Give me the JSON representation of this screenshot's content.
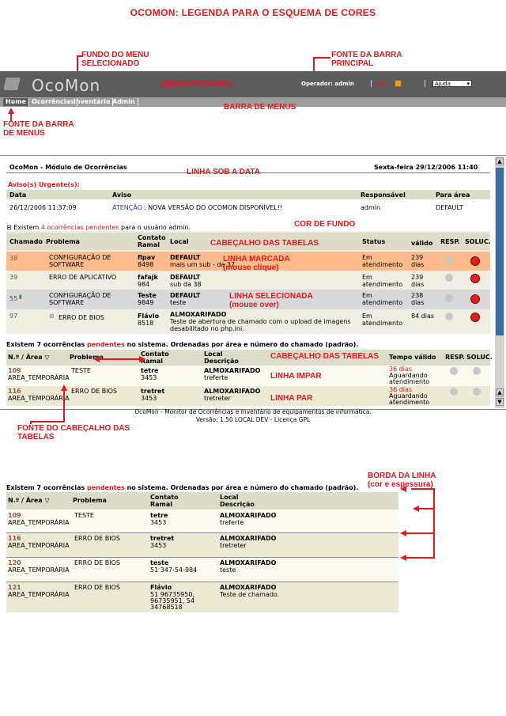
{
  "title": "OCOMON: LEGENDA PARA O ESQUEMA DE CORES",
  "annotations": {
    "fundo_menu_sel": "FUNDO DO MENU\nSELECIONADO",
    "fonte_barra_principal": "FONTE DA BARRA\nPRINCIPAL",
    "barra_principal": "BARRA PRINCIPAL",
    "barra_de_menus": "BARRA DE MENUS",
    "fonte_barra_menus": "FONTE DA BARRA\nDE MENUS",
    "linha_sob_data": "LINHA SOB A DATA",
    "cor_de_fundo": "COR DE FUNDO",
    "cabecalho_tabelas": "CABEÇALHO DAS TABELAS",
    "linha_marcada": "LINHA MARCADA",
    "mouse_clique": "(mouse clique)",
    "linha_selecionada": "LINHA SELECIONADA",
    "mouse_over": "(mouse over)",
    "cabecalho_tabelas2": "CABEÇALHO DAS TABELAS",
    "linha_impar": "LINHA IMPAR",
    "linha_par": "LINHA PAR",
    "fonte_cabecalho": "FONTE DO CABEÇALHO DAS\nTABELAS",
    "borda_linha": "BORDA DA LINHA\n(cor e espessura)"
  },
  "app": {
    "logo": "OcoMon",
    "operator": "Operador: admin",
    "sair": "sair",
    "select_value": "Ajuda",
    "menu": [
      "Home",
      "Ocorrências",
      "Inventário",
      "Admin"
    ]
  },
  "module": {
    "heading": "OcoMon - Módulo de Ocorrências",
    "date": "Sexta-feira 29/12/2006 11:40",
    "urgent_label": "Aviso(s) Urgente(s):",
    "notice_headers": [
      "Data",
      "Aviso",
      "Responsável",
      "Para área"
    ],
    "notice": {
      "data": "26/12/2006 11:37:09",
      "atencao": "ATENÇÃO",
      "msg": ": NOVA VERSÃO DO OCOMON DISPONÍVEL!!",
      "resp": "admin",
      "area": "DEFAULT"
    },
    "pend_prefix": "Existem ",
    "pend_count": "4 ocorrências pendentes",
    "pend_suffix": " para o usuário admin.",
    "headers": {
      "chamado": "Chamado",
      "problema": "Problema",
      "contato": "Contato",
      "ramal": "Ramal",
      "local": "Local",
      "status": "Status",
      "valido": "válido",
      "resp": "RESP.",
      "soluc": "SOLUC."
    },
    "rows": [
      {
        "chamado": "38",
        "problema": "CONFIGURAÇÃO DE",
        "problema2": "SOFTWARE",
        "contato": "flpav",
        "ramal": "8498",
        "local": "DEFAULT",
        "local2": "mais um sub - da 37",
        "status": "Em",
        "status2": "atendimento",
        "valido": "239",
        "valido2": "dias"
      },
      {
        "chamado": "39",
        "problema": "ERRO DE APLICATIVO",
        "problema2": "",
        "contato": "fafajk",
        "ramal": "984",
        "local": "DEFAULT",
        "local2": "sub da 38",
        "status": "Em",
        "status2": "atendimento",
        "valido": "239",
        "valido2": "dias"
      },
      {
        "chamado": "55",
        "problema": "CONFIGURAÇÃO DE",
        "problema2": "SOFTWARE",
        "contato": "Teste",
        "ramal": "9849",
        "local": "DEFAULT",
        "local2": "teste",
        "status": "Em",
        "status2": "atendimento",
        "valido": "238",
        "valido2": "dias"
      },
      {
        "chamado": "97",
        "problema": "ERRO DE BIOS",
        "problema2": "",
        "contato": "Flávio",
        "ramal": "8518",
        "local": "ALMOXARIFADO",
        "local2": "Teste de abertura de chamado com o upload de imagens",
        "local3": "desabilitado no php.ini.",
        "status": "Em",
        "status2": "atendimento",
        "valido": "84 dias",
        "valido2": ""
      }
    ],
    "sys_prefix": "Existem 7 ocorrências ",
    "sys_pend": "pendentes",
    "sys_suffix": " no sistema. Ordenadas por área e número do chamado (padrão).",
    "t2_headers": {
      "num": "N.º / Área ▽",
      "problema": "Problema",
      "contato": "Contato",
      "ramal": "Ramal",
      "local": "Local",
      "descricao": "Descrição",
      "tempo": "Tempo válido",
      "resp": "RESP.",
      "soluc": "SOLUC."
    },
    "t2_rows": [
      {
        "num": "109",
        "area": "AREA_TEMPORÁRIA",
        "problema": "TESTE",
        "contato": "tetre",
        "ramal": "3453",
        "local": "ALMOXARIFADO",
        "desc": "treferte",
        "tempo": "36 dias",
        "t2": "Aguardando",
        "t3": "atendimento"
      },
      {
        "num": "116",
        "area": "AREA_TEMPORÁRIA",
        "problema": "ERRO DE BIOS",
        "contato": "tretret",
        "ramal": "3453",
        "local": "ALMOXARIFADO",
        "desc": "tretreter",
        "tempo": "36 dias",
        "t2": "Aguardando",
        "t3": "atendimento"
      }
    ],
    "footer1": "OcoMon - Monitor de Ocorrências e Inventário de equipamentos de informática.",
    "footer2": "Versão: 1.50 LOCAL DEV - Licença GPL"
  },
  "zoom": {
    "headers": {
      "num": "N.º / Área ▽",
      "problema": "Problema",
      "contato": "Contato",
      "ramal": "Ramal",
      "local": "Local",
      "descricao": "Descrição"
    },
    "rows": [
      {
        "num": "109",
        "area": "AREA_TEMPORÁRIA",
        "problema": "TESTE",
        "contato": "tetre",
        "ramal": "3453",
        "local": "ALMOXARIFADO",
        "desc": "treferte"
      },
      {
        "num": "116",
        "area": "AREA_TEMPORÁRIA",
        "problema": "ERRO DE BIOS",
        "contato": "tretret",
        "ramal": "3453",
        "local": "ALMOXARIFADO",
        "desc": "tretreter"
      },
      {
        "num": "120",
        "area": "AREA_TEMPORÁRIA",
        "problema": "ERRO DE BIOS",
        "contato": "teste",
        "ramal": "51 347-54-984",
        "local": "ALMOXARIFADO",
        "desc": "teste"
      },
      {
        "num": "121",
        "area": "AREA_TEMPORÁRIA",
        "problema": "ERRO DE BIOS",
        "contato": "Flávio",
        "ramal": "51 96735950,",
        "ramal2": "96735951, 54",
        "ramal3": "34768518",
        "local": "ALMOXARIFADO",
        "desc": "Teste de chamado."
      }
    ]
  }
}
